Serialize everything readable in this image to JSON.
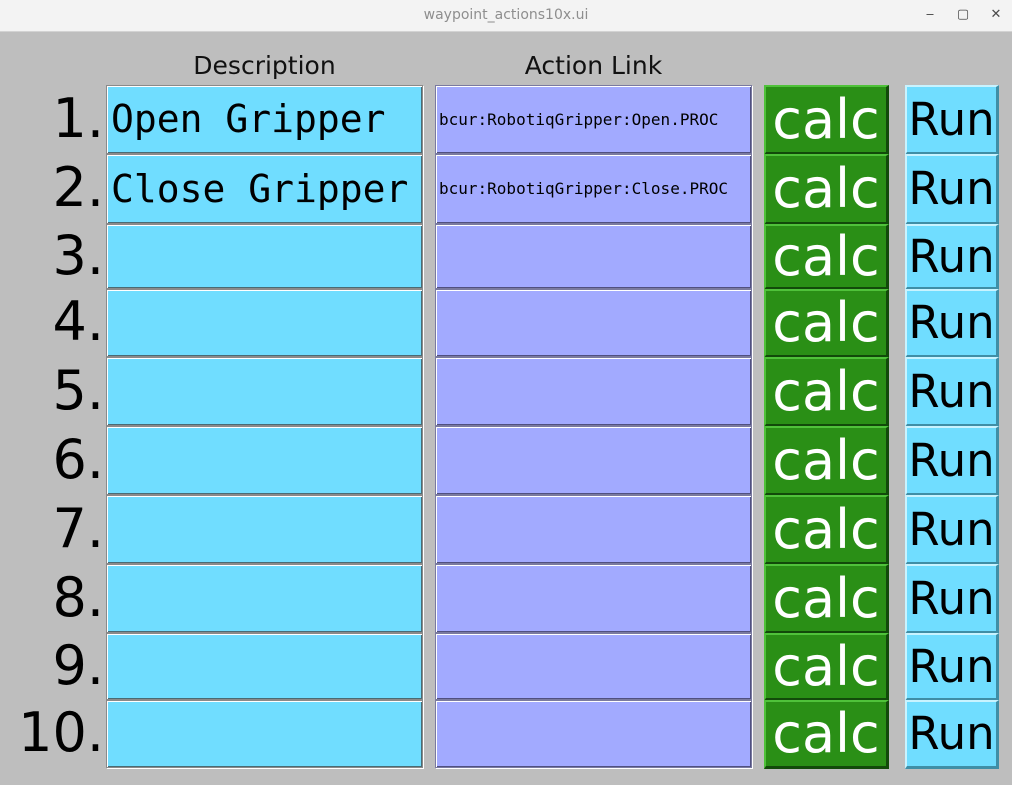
{
  "window": {
    "title": "waypoint_actions10x.ui",
    "minimize_glyph": "‒",
    "maximize_glyph": "▢",
    "close_glyph": "✕"
  },
  "headers": {
    "description": "Description",
    "action_link": "Action Link"
  },
  "rows": [
    {
      "number": "1.",
      "description": "Open Gripper",
      "action_link": "bcur:RobotiqGripper:Open.PROC",
      "calc_label": "calc",
      "run_label": "Run"
    },
    {
      "number": "2.",
      "description": "Close Gripper",
      "action_link": "bcur:RobotiqGripper:Close.PROC",
      "calc_label": "calc",
      "run_label": "Run"
    },
    {
      "number": "3.",
      "description": "",
      "action_link": "",
      "calc_label": "calc",
      "run_label": "Run"
    },
    {
      "number": "4.",
      "description": "",
      "action_link": "",
      "calc_label": "calc",
      "run_label": "Run"
    },
    {
      "number": "5.",
      "description": "",
      "action_link": "",
      "calc_label": "calc",
      "run_label": "Run"
    },
    {
      "number": "6.",
      "description": "",
      "action_link": "",
      "calc_label": "calc",
      "run_label": "Run"
    },
    {
      "number": "7.",
      "description": "",
      "action_link": "",
      "calc_label": "calc",
      "run_label": "Run"
    },
    {
      "number": "8.",
      "description": "",
      "action_link": "",
      "calc_label": "calc",
      "run_label": "Run"
    },
    {
      "number": "9.",
      "description": "",
      "action_link": "",
      "calc_label": "calc",
      "run_label": "Run"
    },
    {
      "number": "10.",
      "description": "",
      "action_link": "",
      "calc_label": "calc",
      "run_label": "Run"
    }
  ],
  "colors": {
    "background": "#bebebe",
    "description_field": "#70ddff",
    "action_link_field": "#a2aaff",
    "calc_button": "#2a8f16",
    "run_button": "#70ddff"
  }
}
